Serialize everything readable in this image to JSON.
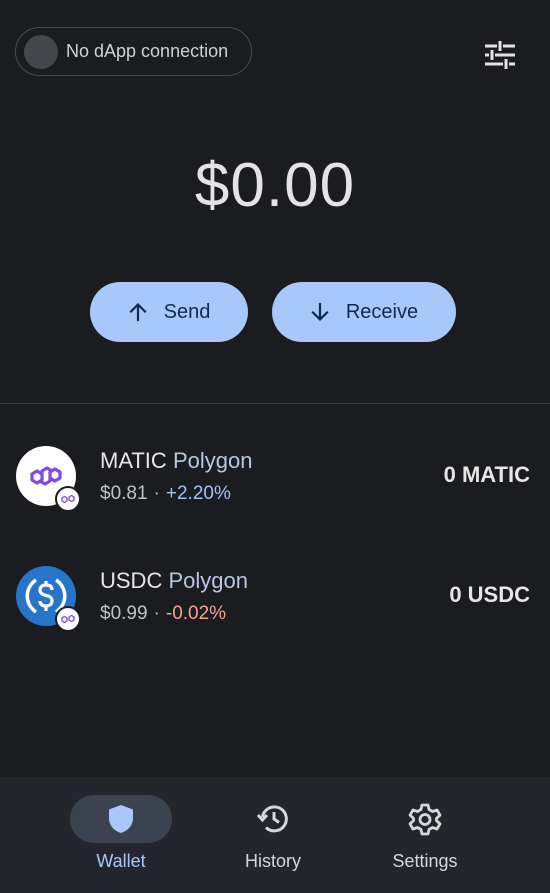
{
  "header": {
    "dapp_status": "No dApp connection"
  },
  "balance": {
    "total": "$0.00"
  },
  "actions": {
    "send_label": "Send",
    "receive_label": "Receive"
  },
  "tokens": [
    {
      "symbol": "MATIC",
      "chain": "Polygon",
      "price": "$0.81",
      "change": "+2.20%",
      "amount": "0 MATIC",
      "icon": "polygon-icon"
    },
    {
      "symbol": "USDC",
      "chain": "Polygon",
      "price": "$0.99",
      "change": "-0.02%",
      "amount": "0 USDC",
      "icon": "usdc-icon"
    }
  ],
  "separator": "·",
  "nav": {
    "items": [
      {
        "label": "Wallet",
        "icon": "shield-icon",
        "active": true
      },
      {
        "label": "History",
        "icon": "history-icon",
        "active": false
      },
      {
        "label": "Settings",
        "icon": "gear-icon",
        "active": false
      }
    ]
  },
  "colors": {
    "background": "#1b1c1f",
    "accent": "#a8c8fb",
    "positive": "#9fc1f7",
    "negative": "#f5a193",
    "nav_background": "#23262d"
  }
}
